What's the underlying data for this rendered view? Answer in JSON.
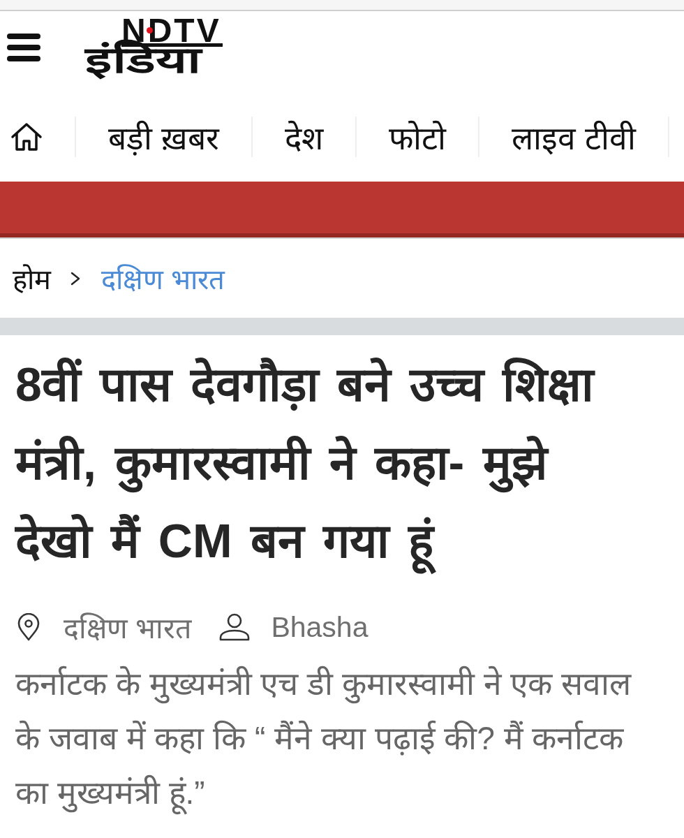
{
  "header": {
    "logo": {
      "latin": "NDTV",
      "devanagari": "इंडिया"
    }
  },
  "nav": {
    "items": [
      {
        "kind": "home"
      },
      {
        "kind": "link",
        "label": "बड़ी ख़बर"
      },
      {
        "kind": "link",
        "label": "देश"
      },
      {
        "kind": "link",
        "label": "फोटो"
      },
      {
        "kind": "link",
        "label": "लाइव टीवी"
      }
    ]
  },
  "breadcrumb": [
    {
      "kind": "home",
      "label": "होम"
    },
    {
      "kind": "section",
      "label": "दक्षिण भारत"
    }
  ],
  "article": {
    "headline": "8वीं पास देवगौड़ा बने उच्च शिक्षा मंत्री, कुमारस्वामी ने कहा- मुझे देखो मैं CM बन गया हूं",
    "location": "दक्षिण भारत",
    "author": "Bhasha",
    "summary": "कर्नाटक के मुख्यमंत्री एच डी कुमारस्वामी ने एक सवाल के जवाब में कहा कि “ मैंने क्या पढ़ाई की? मैं कर्नाटक का मुख्यमंत्री हूं.”"
  }
}
